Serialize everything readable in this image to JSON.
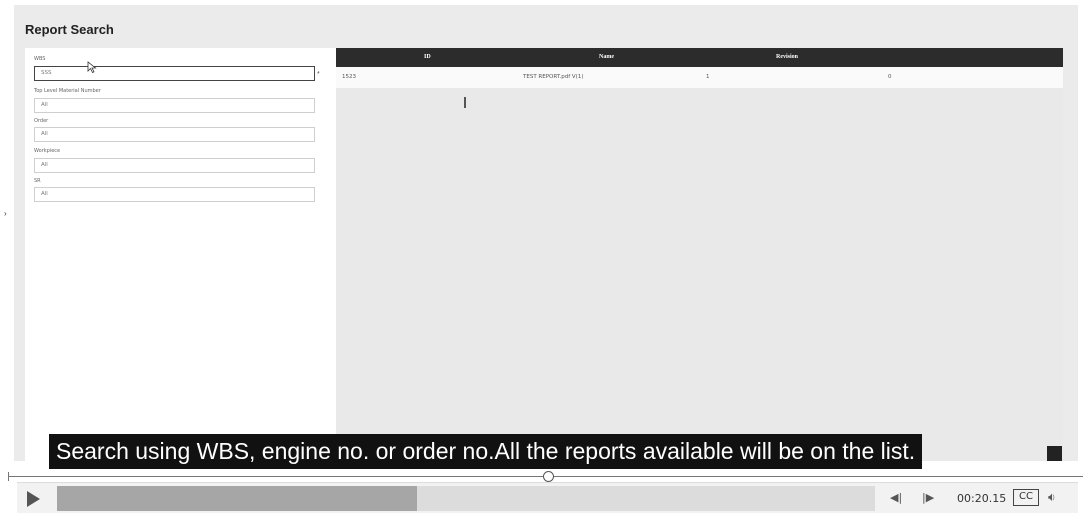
{
  "page": {
    "title": "Report Search"
  },
  "filters": [
    {
      "label": "WBS",
      "value": "SSS",
      "active": true
    },
    {
      "label": "Top Level Material Number",
      "value": "All"
    },
    {
      "label": "Order",
      "value": "All"
    },
    {
      "label": "Workpiece",
      "value": "All"
    },
    {
      "label": "SR",
      "value": "All"
    }
  ],
  "required_mark": "*",
  "results": {
    "columns": [
      "ID",
      "Name",
      "Revision"
    ],
    "rows": [
      [
        "1523",
        "TEST REPORT.pdf V(1)",
        "1",
        "0"
      ]
    ]
  },
  "video": {
    "subtitle": "Search using WBS, engine no. or order no.All the reports available will be on the list.",
    "time": "00:20.15",
    "cc_label": "CC",
    "progress": 0.44,
    "timeline_position": 0.5,
    "icons": {
      "play": "play-icon",
      "prev": "previous-frame-icon",
      "next": "next-frame-icon",
      "volume": "volume-icon"
    }
  }
}
